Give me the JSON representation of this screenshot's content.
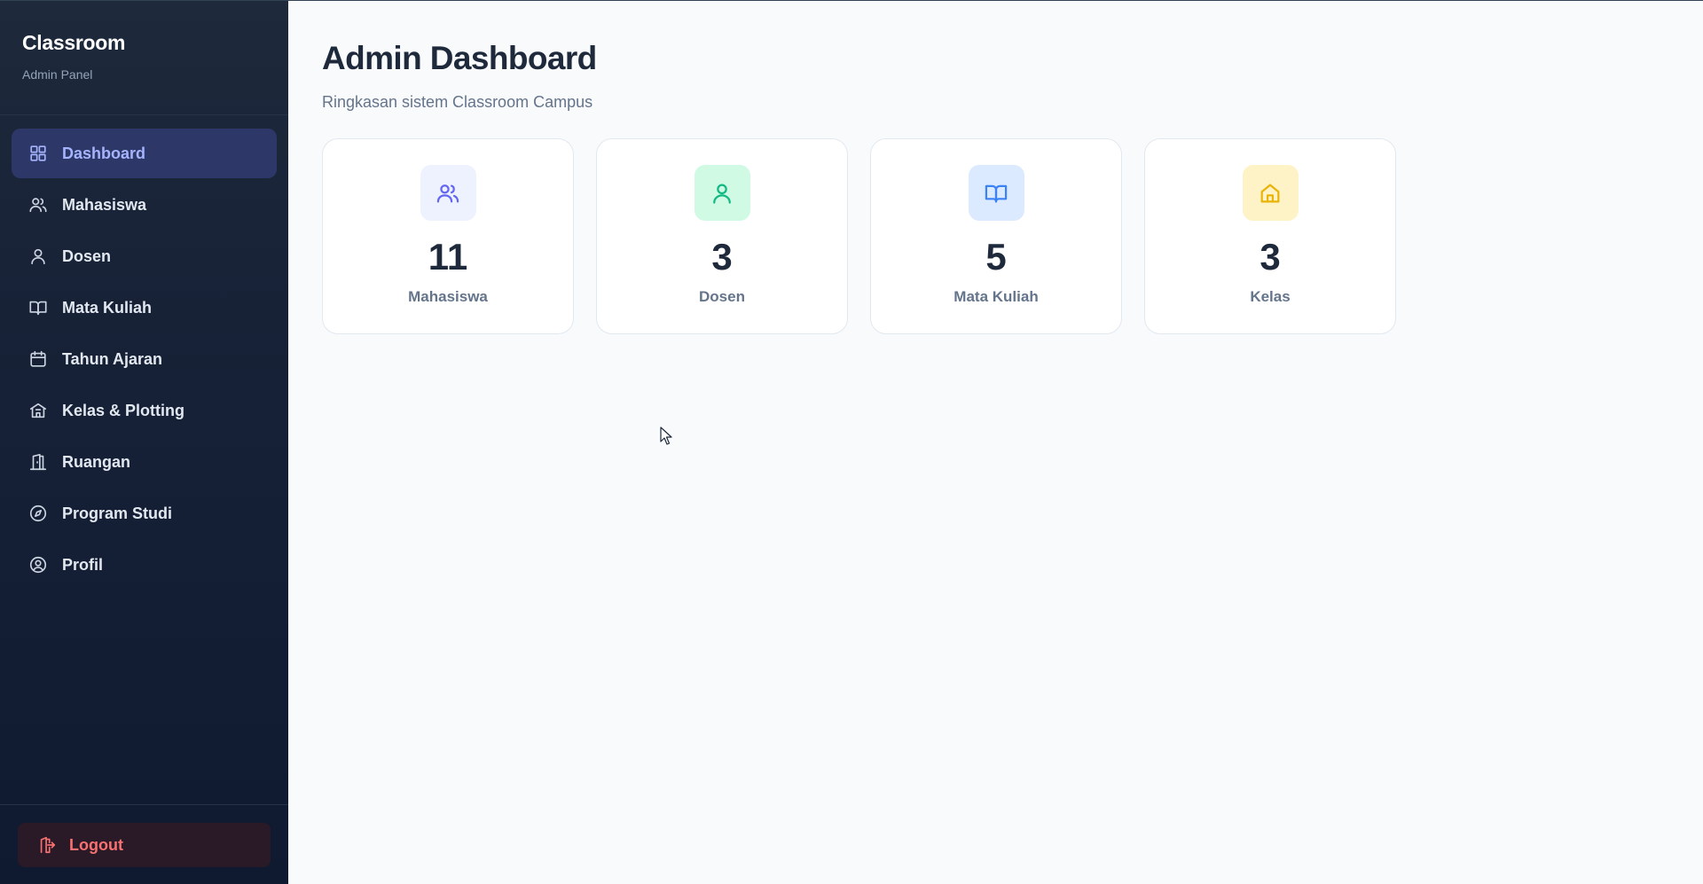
{
  "colors": {
    "sidebar_bg": "#1a2438",
    "active_bg": "#2e3868",
    "active_text": "#a5b4fc",
    "logout_text": "#f87171",
    "page_bg": "#f8fafc"
  },
  "sidebar": {
    "brand_title": "Classroom",
    "brand_subtitle": "Admin Panel",
    "items": [
      {
        "label": "Dashboard",
        "icon": "grid-icon",
        "active": true
      },
      {
        "label": "Mahasiswa",
        "icon": "users-icon",
        "active": false
      },
      {
        "label": "Dosen",
        "icon": "user-icon",
        "active": false
      },
      {
        "label": "Mata Kuliah",
        "icon": "book-icon",
        "active": false
      },
      {
        "label": "Tahun Ajaran",
        "icon": "calendar-icon",
        "active": false
      },
      {
        "label": "Kelas & Plotting",
        "icon": "school-icon",
        "active": false
      },
      {
        "label": "Ruangan",
        "icon": "door-icon",
        "active": false
      },
      {
        "label": "Program Studi",
        "icon": "compass-icon",
        "active": false
      },
      {
        "label": "Profil",
        "icon": "user-circle-icon",
        "active": false
      }
    ],
    "logout_label": "Logout"
  },
  "main": {
    "title": "Admin Dashboard",
    "subtitle": "Ringkasan sistem Classroom Campus",
    "stats": [
      {
        "value": "11",
        "label": "Mahasiswa",
        "icon": "users-icon",
        "icon_bg": "#eef2ff",
        "icon_color": "#6366f1"
      },
      {
        "value": "3",
        "label": "Dosen",
        "icon": "user-icon",
        "icon_bg": "#d1fae5",
        "icon_color": "#10b981"
      },
      {
        "value": "5",
        "label": "Mata Kuliah",
        "icon": "book-icon",
        "icon_bg": "#dbeafe",
        "icon_color": "#3b82f6"
      },
      {
        "value": "3",
        "label": "Kelas",
        "icon": "home-icon",
        "icon_bg": "#fef3c7",
        "icon_color": "#eab308"
      }
    ]
  }
}
